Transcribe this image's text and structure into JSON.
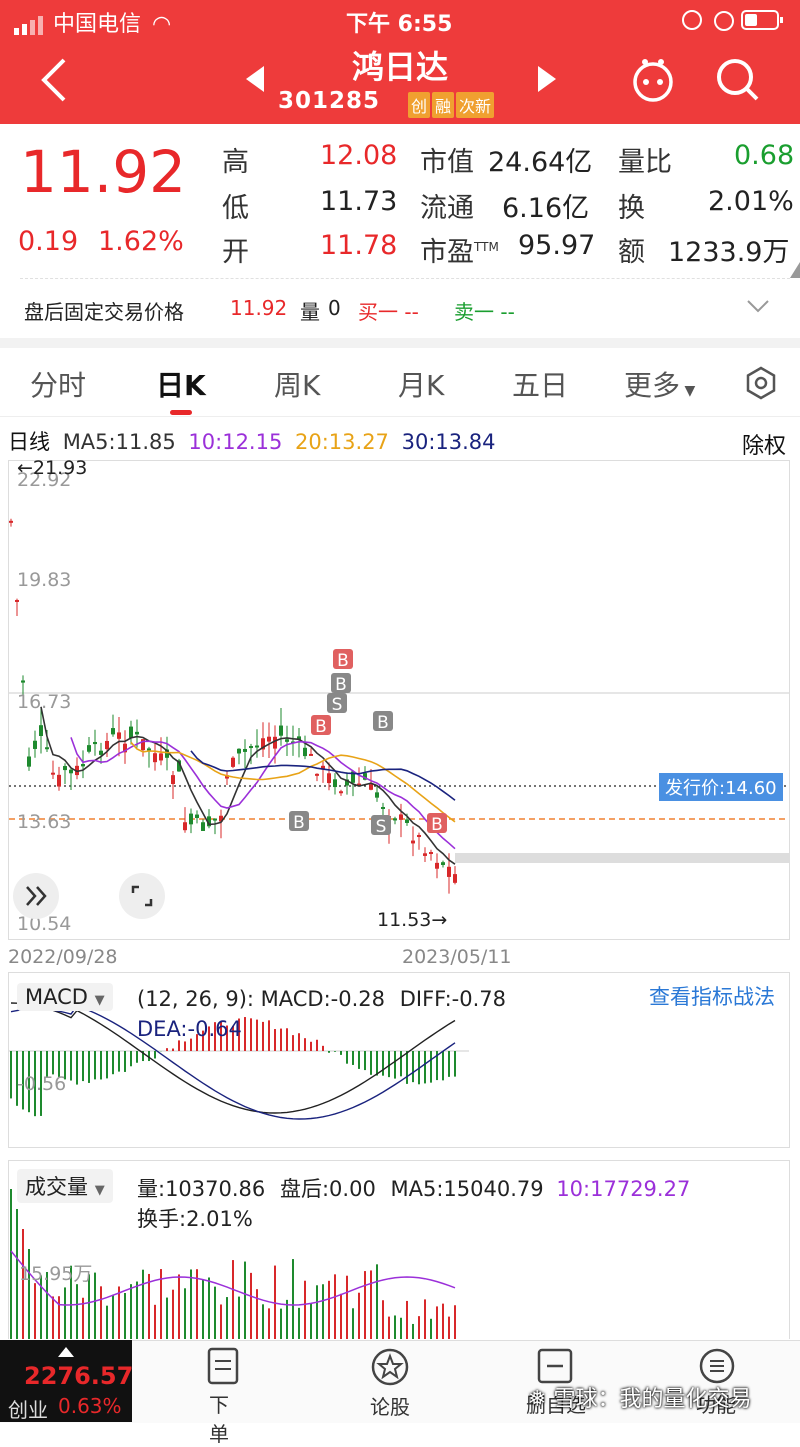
{
  "status_bar": {
    "carrier": "中国电信",
    "time": "下午 6:55"
  },
  "header": {
    "title": "鸿日达",
    "code": "301285",
    "tags": [
      "创",
      "融",
      "次新"
    ]
  },
  "quote": {
    "price": "11.92",
    "change": "0.19",
    "change_pct": "1.62%",
    "rows": [
      {
        "l1": "高",
        "v1": "12.08",
        "l2": "市值",
        "v2": "24.64亿",
        "l3": "量比",
        "v3": "0.68"
      },
      {
        "l1": "低",
        "v1": "11.73",
        "l2": "流通",
        "v2": "6.16亿",
        "l3": "换",
        "v3": "2.01%"
      },
      {
        "l1": "开",
        "v1": "11.78",
        "l2": "市盈",
        "l2_sup": "TTM",
        "v2": "95.97",
        "l3": "额",
        "v3": "1233.9万"
      }
    ],
    "after_hours_label": "盘后固定交易价格",
    "after_hours_price": "11.92",
    "vol_label": "量",
    "vol_value": "0",
    "buy1": "买一 --",
    "sell1": "卖一 --"
  },
  "tabs": [
    "分时",
    "日K",
    "周K",
    "月K",
    "五日",
    "更多"
  ],
  "kline": {
    "period": "日线",
    "ma": [
      {
        "label": "MA5:11.85",
        "color": "#333333"
      },
      {
        "label": "10:12.15",
        "color": "#9b30d9"
      },
      {
        "label": "20:13.27",
        "color": "#e8a317"
      },
      {
        "label": "30:13.84",
        "color": "#1a237e"
      }
    ],
    "adjust": "除权",
    "y_ticks": [
      "22.92",
      "19.83",
      "16.73",
      "13.63",
      "10.54"
    ],
    "max_label": "←21.93",
    "min_label": "11.53→",
    "issue_price_label": "发行价:14.60",
    "start_date": "2022/09/28",
    "end_date": "2023/05/11",
    "markers": [
      "B",
      "B",
      "S",
      "B",
      "B",
      "B",
      "S",
      "B"
    ]
  },
  "macd": {
    "dropdown": "MACD",
    "params": "(12, 26, 9):",
    "macd": "MACD:-0.28",
    "diff": "DIFF:-0.78",
    "dea": "DEA:-0.64",
    "tick": "-0.56",
    "link": "查看指标战法"
  },
  "volume": {
    "dropdown": "成交量",
    "vol": "量:10370.86",
    "after": "盘后:0.00",
    "ma5": "MA5:15040.79",
    "ma10": "10:17729.27",
    "turnover": "换手:2.01%",
    "tick": "15.95万"
  },
  "bottom": {
    "index_value": "2276.57",
    "index_name": "创业",
    "index_pct": "0.63%",
    "items": [
      "下单",
      "论股",
      "删自选",
      "功能"
    ],
    "watermark": "雪球：我的量化交易"
  }
}
